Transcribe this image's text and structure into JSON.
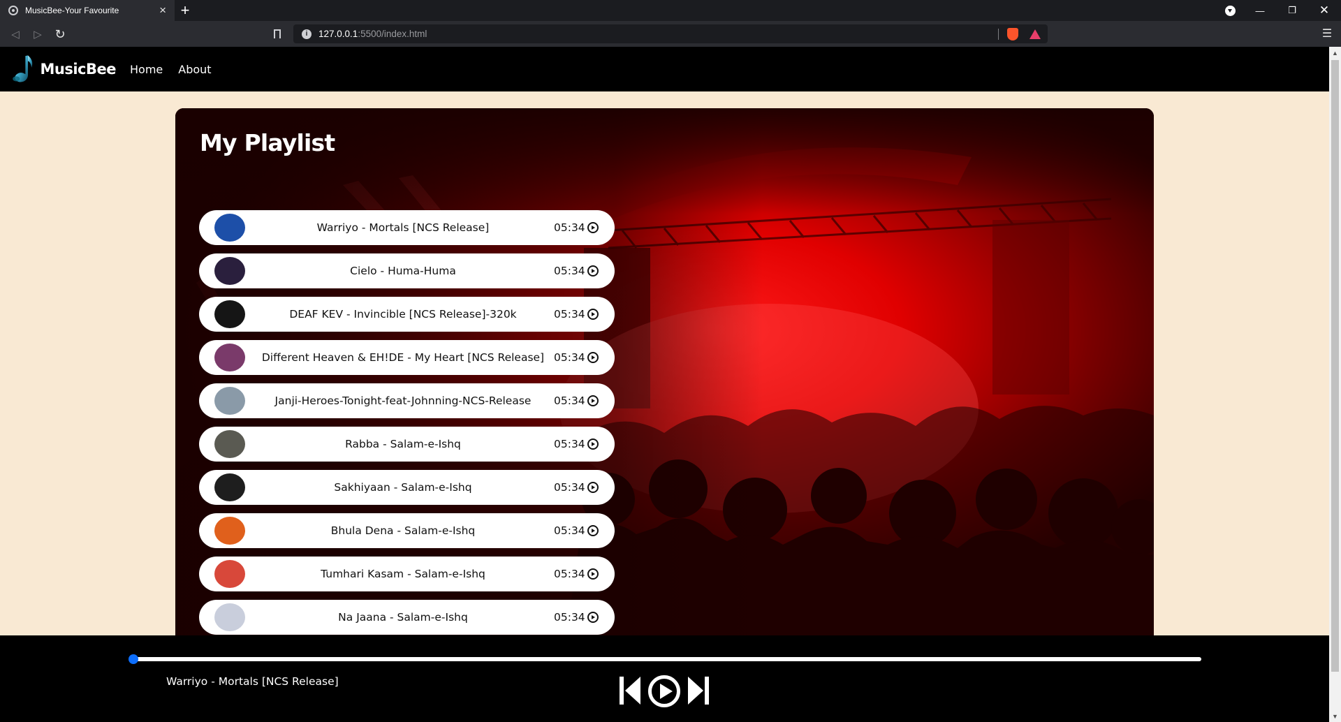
{
  "browser": {
    "tab_title": "MusicBee-Your Favourite",
    "tab_close": "×",
    "new_tab": "+",
    "url_host": "127.0.0.1",
    "url_port": ":5500",
    "url_path": "/index.html",
    "window_min": "—",
    "window_max": "❐",
    "window_close": "✕"
  },
  "nav": {
    "brand": "MusicBee",
    "links": [
      "Home",
      "About"
    ]
  },
  "playlist": {
    "heading": "My Playlist",
    "songs": [
      {
        "title": "Warriyo - Mortals [NCS Release]",
        "duration": "05:34",
        "cover_color": "#1d4fa8"
      },
      {
        "title": "Cielo - Huma-Huma",
        "duration": "05:34",
        "cover_color": "#2a1f3d"
      },
      {
        "title": "DEAF KEV - Invincible [NCS Release]-320k",
        "duration": "05:34",
        "cover_color": "#151515"
      },
      {
        "title": "Different Heaven & EH!DE - My Heart [NCS Release]",
        "duration": "05:34",
        "cover_color": "#7a3a6a"
      },
      {
        "title": "Janji-Heroes-Tonight-feat-Johnning-NCS-Release",
        "duration": "05:34",
        "cover_color": "#8a9aa8"
      },
      {
        "title": "Rabba - Salam-e-Ishq",
        "duration": "05:34",
        "cover_color": "#5a5a52"
      },
      {
        "title": "Sakhiyaan - Salam-e-Ishq",
        "duration": "05:34",
        "cover_color": "#1e1e1e"
      },
      {
        "title": "Bhula Dena - Salam-e-Ishq",
        "duration": "05:34",
        "cover_color": "#e0601c"
      },
      {
        "title": "Tumhari Kasam - Salam-e-Ishq",
        "duration": "05:34",
        "cover_color": "#d8483a"
      },
      {
        "title": "Na Jaana - Salam-e-Ishq",
        "duration": "05:34",
        "cover_color": "#c9cedc"
      }
    ]
  },
  "player": {
    "now_playing": "Warriyo - Mortals [NCS Release]",
    "progress": 0,
    "accent": "#0d6efd"
  }
}
